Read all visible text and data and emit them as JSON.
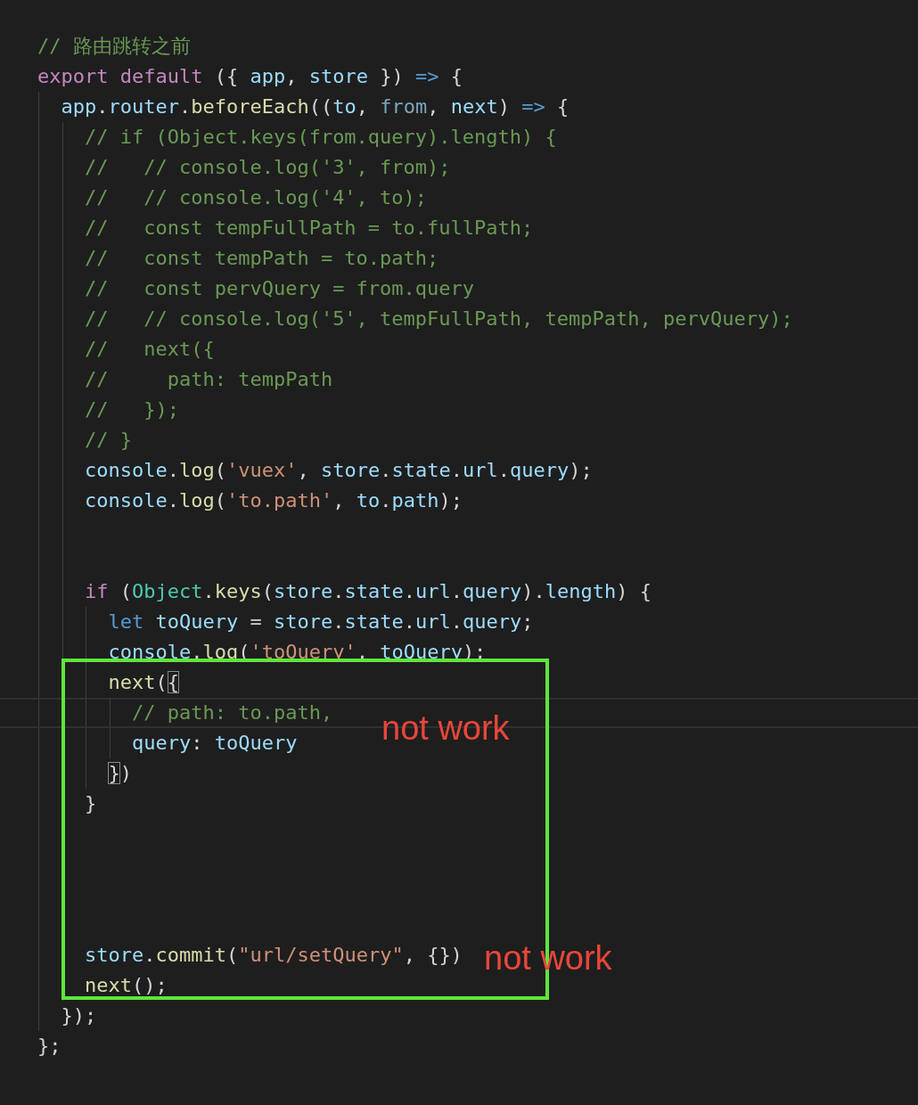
{
  "editor": {
    "lines": [
      {
        "current": false,
        "tokens": [
          {
            "text": "// 路由跳转之前",
            "kind": "comment"
          }
        ]
      },
      {
        "current": false,
        "tokens": [
          {
            "text": "export default",
            "kind": "keyword"
          },
          {
            "text": " ({ ",
            "kind": "plain"
          },
          {
            "text": "app",
            "kind": "var"
          },
          {
            "text": ", ",
            "kind": "plain"
          },
          {
            "text": "store",
            "kind": "var"
          },
          {
            "text": " }) ",
            "kind": "plain"
          },
          {
            "text": "=>",
            "kind": "storage"
          },
          {
            "text": " {",
            "kind": "plain"
          }
        ]
      },
      {
        "current": false,
        "tokens": [
          {
            "text": "  app",
            "kind": "var"
          },
          {
            "text": ".",
            "kind": "plain"
          },
          {
            "text": "router",
            "kind": "var"
          },
          {
            "text": ".",
            "kind": "plain"
          },
          {
            "text": "beforeEach",
            "kind": "func"
          },
          {
            "text": "((",
            "kind": "plain"
          },
          {
            "text": "to",
            "kind": "var"
          },
          {
            "text": ", ",
            "kind": "plain"
          },
          {
            "text": "from",
            "kind": "unused"
          },
          {
            "text": ", ",
            "kind": "plain"
          },
          {
            "text": "next",
            "kind": "var"
          },
          {
            "text": ") ",
            "kind": "plain"
          },
          {
            "text": "=>",
            "kind": "storage"
          },
          {
            "text": " {",
            "kind": "plain"
          }
        ]
      },
      {
        "current": false,
        "tokens": [
          {
            "text": "    // if (Object.keys(from.query).length) {",
            "kind": "comment"
          }
        ]
      },
      {
        "current": false,
        "tokens": [
          {
            "text": "    //   // console.log('3', from);",
            "kind": "comment"
          }
        ]
      },
      {
        "current": false,
        "tokens": [
          {
            "text": "    //   // console.log('4', to);",
            "kind": "comment"
          }
        ]
      },
      {
        "current": false,
        "tokens": [
          {
            "text": "    //   const tempFullPath = to.fullPath;",
            "kind": "comment"
          }
        ]
      },
      {
        "current": false,
        "tokens": [
          {
            "text": "    //   const tempPath = to.path;",
            "kind": "comment"
          }
        ]
      },
      {
        "current": false,
        "tokens": [
          {
            "text": "    //   const pervQuery = from.query",
            "kind": "comment"
          }
        ]
      },
      {
        "current": false,
        "tokens": [
          {
            "text": "    //   // console.log('5', tempFullPath, tempPath, pervQuery);",
            "kind": "comment"
          }
        ]
      },
      {
        "current": false,
        "tokens": [
          {
            "text": "    //   next({",
            "kind": "comment"
          }
        ]
      },
      {
        "current": false,
        "tokens": [
          {
            "text": "    //     path: tempPath",
            "kind": "comment"
          }
        ]
      },
      {
        "current": false,
        "tokens": [
          {
            "text": "    //   });",
            "kind": "comment"
          }
        ]
      },
      {
        "current": false,
        "tokens": [
          {
            "text": "    // }",
            "kind": "comment"
          }
        ]
      },
      {
        "current": false,
        "tokens": [
          {
            "text": "    console",
            "kind": "var"
          },
          {
            "text": ".",
            "kind": "plain"
          },
          {
            "text": "log",
            "kind": "func"
          },
          {
            "text": "(",
            "kind": "plain"
          },
          {
            "text": "'vuex'",
            "kind": "string"
          },
          {
            "text": ", ",
            "kind": "plain"
          },
          {
            "text": "store",
            "kind": "var"
          },
          {
            "text": ".",
            "kind": "plain"
          },
          {
            "text": "state",
            "kind": "var"
          },
          {
            "text": ".",
            "kind": "plain"
          },
          {
            "text": "url",
            "kind": "var"
          },
          {
            "text": ".",
            "kind": "plain"
          },
          {
            "text": "query",
            "kind": "var"
          },
          {
            "text": ");",
            "kind": "plain"
          }
        ]
      },
      {
        "current": false,
        "tokens": [
          {
            "text": "    console",
            "kind": "var"
          },
          {
            "text": ".",
            "kind": "plain"
          },
          {
            "text": "log",
            "kind": "func"
          },
          {
            "text": "(",
            "kind": "plain"
          },
          {
            "text": "'to.path'",
            "kind": "string"
          },
          {
            "text": ", ",
            "kind": "plain"
          },
          {
            "text": "to",
            "kind": "var"
          },
          {
            "text": ".",
            "kind": "plain"
          },
          {
            "text": "path",
            "kind": "var"
          },
          {
            "text": ");",
            "kind": "plain"
          }
        ]
      },
      {
        "current": false
      },
      {
        "current": false
      },
      {
        "current": false,
        "tokens": [
          {
            "text": "    if",
            "kind": "keyword"
          },
          {
            "text": " (",
            "kind": "plain"
          },
          {
            "text": "Object",
            "kind": "class"
          },
          {
            "text": ".",
            "kind": "plain"
          },
          {
            "text": "keys",
            "kind": "func"
          },
          {
            "text": "(",
            "kind": "plain"
          },
          {
            "text": "store",
            "kind": "var"
          },
          {
            "text": ".",
            "kind": "plain"
          },
          {
            "text": "state",
            "kind": "var"
          },
          {
            "text": ".",
            "kind": "plain"
          },
          {
            "text": "url",
            "kind": "var"
          },
          {
            "text": ".",
            "kind": "plain"
          },
          {
            "text": "query",
            "kind": "var"
          },
          {
            "text": ").",
            "kind": "plain"
          },
          {
            "text": "length",
            "kind": "var"
          },
          {
            "text": ") {",
            "kind": "plain"
          }
        ]
      },
      {
        "current": false,
        "tokens": [
          {
            "text": "      let",
            "kind": "storage"
          },
          {
            "text": " toQuery",
            "kind": "var"
          },
          {
            "text": " = ",
            "kind": "plain"
          },
          {
            "text": "store",
            "kind": "var"
          },
          {
            "text": ".",
            "kind": "plain"
          },
          {
            "text": "state",
            "kind": "var"
          },
          {
            "text": ".",
            "kind": "plain"
          },
          {
            "text": "url",
            "kind": "var"
          },
          {
            "text": ".",
            "kind": "plain"
          },
          {
            "text": "query",
            "kind": "var"
          },
          {
            "text": ";",
            "kind": "plain"
          }
        ]
      },
      {
        "current": false,
        "tokens": [
          {
            "text": "      console",
            "kind": "var"
          },
          {
            "text": ".",
            "kind": "plain"
          },
          {
            "text": "log",
            "kind": "func"
          },
          {
            "text": "(",
            "kind": "plain"
          },
          {
            "text": "'toQuery'",
            "kind": "string"
          },
          {
            "text": ", ",
            "kind": "plain"
          },
          {
            "text": "toQuery",
            "kind": "var"
          },
          {
            "text": ");",
            "kind": "plain"
          }
        ]
      },
      {
        "current": false,
        "tokens": [
          {
            "text": "      next",
            "kind": "func"
          },
          {
            "text": "(",
            "kind": "plain"
          },
          {
            "text": "{",
            "kind": "bracket-match"
          }
        ]
      },
      {
        "current": true,
        "tokens": [
          {
            "text": "        // path: to.path,",
            "kind": "comment"
          }
        ]
      },
      {
        "current": false,
        "tokens": [
          {
            "text": "        query",
            "kind": "var"
          },
          {
            "text": ": ",
            "kind": "plain"
          },
          {
            "text": "toQuery",
            "kind": "var"
          }
        ]
      },
      {
        "current": false,
        "tokens": [
          {
            "text": "      }",
            "kind": "bracket-match"
          },
          {
            "text": ")",
            "kind": "plain"
          }
        ]
      },
      {
        "current": false,
        "tokens": [
          {
            "text": "    }",
            "kind": "plain"
          }
        ]
      },
      {
        "current": false
      },
      {
        "current": false
      },
      {
        "current": false
      },
      {
        "current": false
      },
      {
        "current": false,
        "tokens": [
          {
            "text": "    store",
            "kind": "var"
          },
          {
            "text": ".",
            "kind": "plain"
          },
          {
            "text": "commit",
            "kind": "func"
          },
          {
            "text": "(",
            "kind": "plain"
          },
          {
            "text": "\"url/setQuery\"",
            "kind": "string"
          },
          {
            "text": ", {})",
            "kind": "plain"
          }
        ]
      },
      {
        "current": false,
        "tokens": [
          {
            "text": "    next",
            "kind": "func"
          },
          {
            "text": "();",
            "kind": "plain"
          }
        ]
      },
      {
        "current": false,
        "tokens": [
          {
            "text": "  });",
            "kind": "plain"
          }
        ]
      },
      {
        "current": false,
        "tokens": [
          {
            "text": "};",
            "kind": "plain"
          }
        ]
      }
    ]
  },
  "annotations": {
    "notes": [
      {
        "text": "not work"
      },
      {
        "text": "not work"
      }
    ]
  }
}
